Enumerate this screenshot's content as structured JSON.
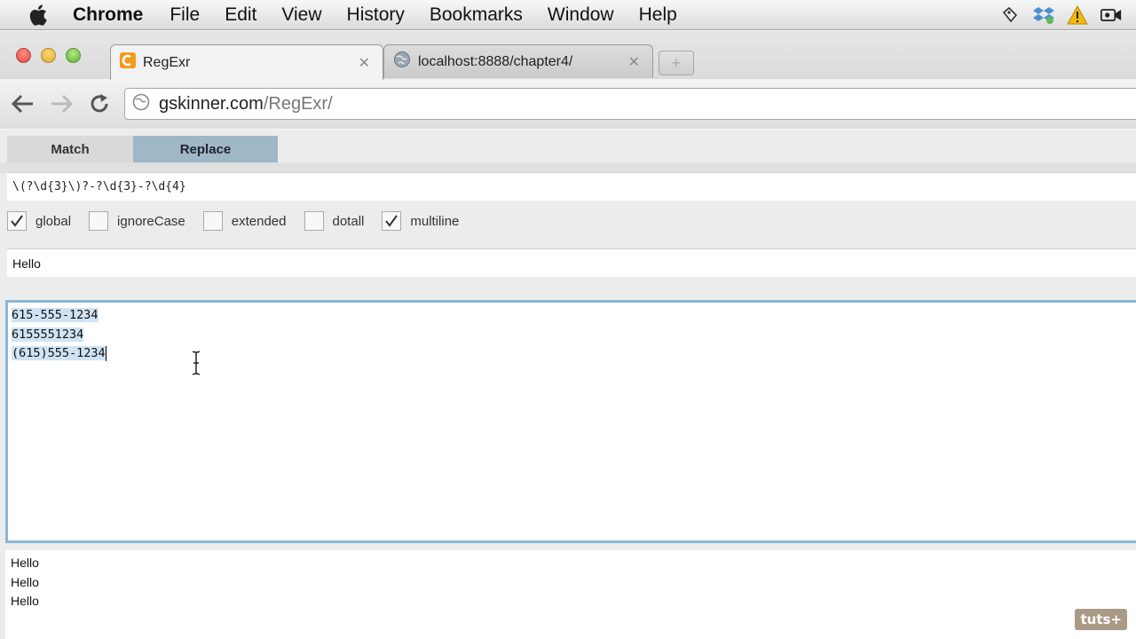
{
  "menubar": {
    "app_name": "Chrome",
    "items": [
      "File",
      "Edit",
      "View",
      "History",
      "Bookmarks",
      "Window",
      "Help"
    ],
    "tray_icons": [
      "evernote-icon",
      "dropbox-icon",
      "warning-icon",
      "video-camera-icon"
    ]
  },
  "browser": {
    "tabs": [
      {
        "title": "RegExr",
        "active": true
      },
      {
        "title": "localhost:8888/chapter4/",
        "active": false
      }
    ],
    "url_host": "gskinner.com",
    "url_path": "/RegExr/"
  },
  "regexr": {
    "modes": [
      "Match",
      "Replace"
    ],
    "active_mode": "Replace",
    "expression": "\\(?\\d{3}\\)?-?\\d{3}-?\\d{4}",
    "flags": [
      {
        "label": "global",
        "checked": true
      },
      {
        "label": "ignoreCase",
        "checked": false
      },
      {
        "label": "extended",
        "checked": false
      },
      {
        "label": "dotall",
        "checked": false
      },
      {
        "label": "multiline",
        "checked": true
      }
    ],
    "replace_value": "Hello",
    "source_lines": [
      "615-555-1234",
      "6155551234",
      "(615)555-1234"
    ],
    "result_lines": [
      "Hello",
      "Hello",
      "Hello"
    ]
  },
  "watermark": "tuts+",
  "colors": {
    "replace_tab": "#9fb7c6",
    "source_border": "#8ab6d6",
    "match_highlight": "#cfe3f4"
  }
}
